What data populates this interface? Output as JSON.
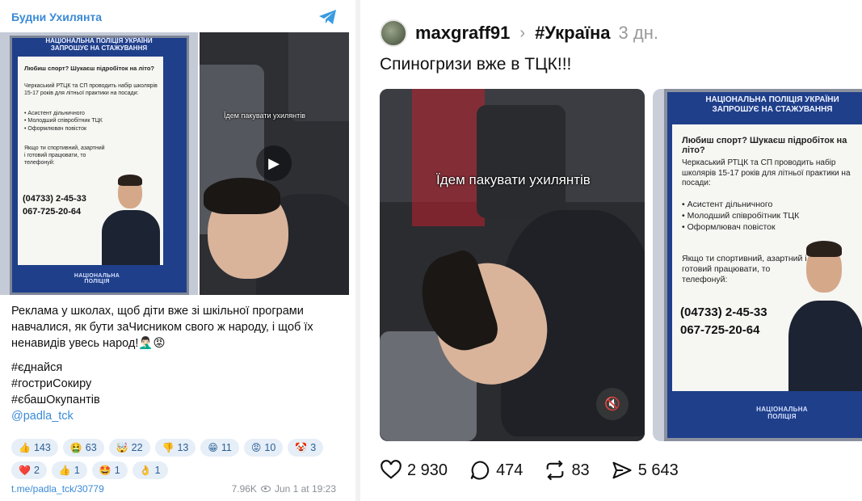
{
  "telegram": {
    "channel_name": "Будни Ухилянта",
    "logo_icon": "telegram-plane-icon",
    "poster": {
      "title": "НАЦІОНАЛЬНА ПОЛІЦІЯ УКРАЇНИ ЗАПРОШУЄ НА СТАЖУВАННЯ",
      "question": "Любиш спорт? Шукаєш підробіток на літо?",
      "body": "Черкаський РТЦК та СП проводить набір школярів 15-17 років для літньої практики на посади:",
      "positions": [
        "Асистент дільничного",
        "Молодший співробітник ТЦК",
        "Оформлювач повісток"
      ],
      "cta": "Якщо ти спортивний, азартний і готовий працювати, то телефонуй:",
      "phone1": "(04733) 2-45-33",
      "phone2": "067-725-20-64",
      "badge": "НАЦІОНАЛЬНА ПОЛІЦІЯ"
    },
    "video": {
      "caption": "Їдем пакувати ухилянтів",
      "play_icon": "play-icon"
    },
    "message": "Реклама у школах, щоб діти вже зі шкільної програми навчалися, як бути заЧисником свого ж народу, і щоб їх ненавидів увесь народ!🤦🏻‍♂️😡",
    "hashtags": [
      "#єднайся",
      "#гостриСокиру",
      "#єбашОкупантів"
    ],
    "mention": "@padla_tck",
    "reactions": [
      {
        "emoji": "👍",
        "count": "143"
      },
      {
        "emoji": "🤮",
        "count": "63"
      },
      {
        "emoji": "🤯",
        "count": "22"
      },
      {
        "emoji": "👎",
        "count": "13"
      },
      {
        "emoji": "😁",
        "count": "11"
      },
      {
        "emoji": "😡",
        "count": "10"
      },
      {
        "emoji": "🤡",
        "count": "3"
      },
      {
        "emoji": "❤️",
        "count": "2"
      },
      {
        "emoji": "👍",
        "count": "1"
      },
      {
        "emoji": "🤩",
        "count": "1"
      },
      {
        "emoji": "👌",
        "count": "1"
      }
    ],
    "footer": {
      "link": "t.me/padla_tck/30779",
      "views": "7.96K",
      "date": "Jun 1 at 19:23"
    }
  },
  "threads": {
    "username": "maxgraff91",
    "topic": "#Україна",
    "time": "3 дн.",
    "caption": "Спиногризи вже в ТЦК!!!",
    "video": {
      "caption": "Їдем пакувати ухилянтів",
      "mute_icon": "speaker-muted-icon"
    },
    "poster": {
      "title": "НАЦІОНАЛЬНА ПОЛІЦІЯ УКРАЇНИ ЗАПРОШУЄ НА СТАЖУВАННЯ",
      "question": "Любиш спорт? Шукаєш підробіток на літо?",
      "body": "Черкаський РТЦК та СП проводить набір школярів 15-17 років для літньої практики на посади:",
      "positions": [
        "Асистент дільничного",
        "Молодший співробітник ТЦК",
        "Оформлювач повісток"
      ],
      "cta": "Якщо ти спортивний, азартний і готовий працювати, то телефонуй:",
      "phone1": "(04733) 2-45-33",
      "phone2": "067-725-20-64",
      "badge": "НАЦІОНАЛЬНА ПОЛІЦІЯ"
    },
    "actions": {
      "likes": "2 930",
      "comments": "474",
      "reposts": "83",
      "shares": "5 643"
    }
  }
}
